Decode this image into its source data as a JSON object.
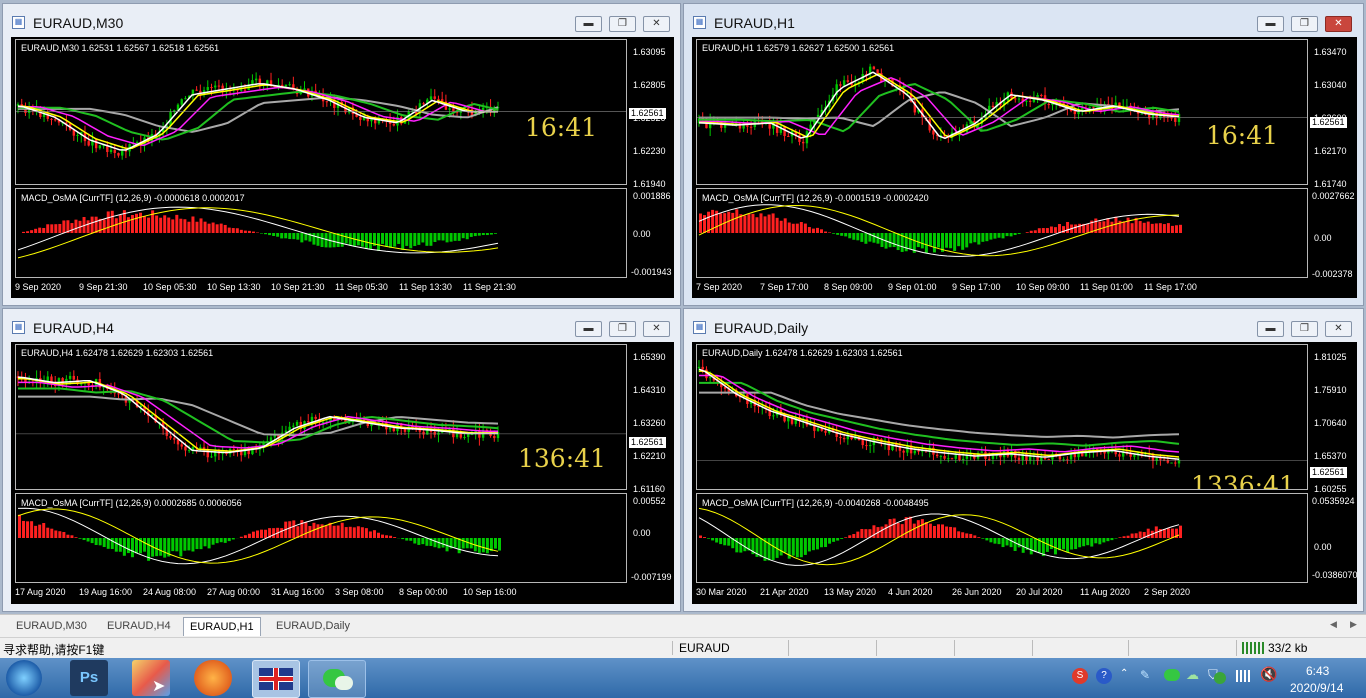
{
  "windows": [
    {
      "id": "m30",
      "title": "EURAUD,M30",
      "info": "EURAUD,M30  1.62531 1.62567 1.62518 1.62561",
      "price_labels": [
        "1.63095",
        "1.62805",
        "1.62520",
        "1.62230",
        "1.61940"
      ],
      "current_price": "1.62561",
      "timer": "16:41",
      "macd_label": "MACD_OsMA [CurrTF] (12,26,9) -0.0000618 0.0002017",
      "macd_labels": [
        "0.001886",
        "0.00",
        "-0.001943"
      ],
      "x_labels": [
        "9 Sep 2020",
        "9 Sep 21:30",
        "10 Sep 05:30",
        "10 Sep 13:30",
        "10 Sep 21:30",
        "11 Sep 05:30",
        "11 Sep 13:30",
        "11 Sep 21:30"
      ]
    },
    {
      "id": "h1",
      "title": "EURAUD,H1",
      "info": "EURAUD,H1  1.62579 1.62627 1.62500 1.62561",
      "price_labels": [
        "1.63470",
        "1.63040",
        "1.62600",
        "1.62170",
        "1.61740"
      ],
      "current_price": "1.62561",
      "timer": "16:41",
      "macd_label": "MACD_OsMA [CurrTF] (12,26,9) -0.0001519 -0.0002420",
      "macd_labels": [
        "0.0027662",
        "0.00",
        "-0.002378"
      ],
      "x_labels": [
        "7 Sep 2020",
        "7 Sep 17:00",
        "8 Sep 09:00",
        "9 Sep 01:00",
        "9 Sep 17:00",
        "10 Sep 09:00",
        "11 Sep 01:00",
        "11 Sep 17:00"
      ]
    },
    {
      "id": "h4",
      "title": "EURAUD,H4",
      "info": "EURAUD,H4  1.62478 1.62629 1.62303 1.62561",
      "price_labels": [
        "1.65390",
        "1.64310",
        "1.63260",
        "1.62210",
        "1.61160"
      ],
      "current_price": "1.62561",
      "timer": "136:41",
      "macd_label": "MACD_OsMA [CurrTF] (12,26,9) 0.0002685 0.0006056",
      "macd_labels": [
        "0.00552",
        "0.00",
        "-0.007199"
      ],
      "x_labels": [
        "17 Aug 2020",
        "19 Aug 16:00",
        "24 Aug 08:00",
        "27 Aug 00:00",
        "31 Aug 16:00",
        "3 Sep 08:00",
        "8 Sep 00:00",
        "10 Sep 16:00"
      ]
    },
    {
      "id": "daily",
      "title": "EURAUD,Daily",
      "info": "EURAUD,Daily  1.62478 1.62629 1.62303 1.62561",
      "price_labels": [
        "1.81025",
        "1.75910",
        "1.70640",
        "1.65370",
        "1.60255"
      ],
      "current_price": "1.62561",
      "timer": "1336:41",
      "macd_label": "MACD_OsMA [CurrTF] (12,26,9) -0.0040268 -0.0048495",
      "macd_labels": [
        "0.0535924",
        "0.00",
        "-0.0386070"
      ],
      "x_labels": [
        "30 Mar 2020",
        "21 Apr 2020",
        "13 May 2020",
        "4 Jun 2020",
        "26 Jun 2020",
        "20 Jul 2020",
        "11 Aug 2020",
        "2 Sep 2020"
      ]
    }
  ],
  "tabs": [
    "EURAUD,M30",
    "EURAUD,H4",
    "EURAUD,H1",
    "EURAUD,Daily"
  ],
  "selected_tab": "EURAUD,H1",
  "status": {
    "help": "寻求帮助,请按F1键",
    "profile": "EURAUD",
    "traffic": "33/2 kb"
  },
  "clock": {
    "time": "6:43",
    "date": "2020/9/14"
  },
  "taskbar_apps": [
    "start",
    "photoshop",
    "paint",
    "orange-app",
    "uk-flag-app",
    "wechat"
  ],
  "colors": {
    "bull": "#00c800",
    "bear": "#ff2020",
    "ma_fast": "#ffffff",
    "ma_yellow": "#ffff00",
    "ma_magenta": "#ff20ff",
    "ma_green": "#20c020",
    "ma_gray": "#a8a8a8",
    "timer": "#e8d14a"
  }
}
